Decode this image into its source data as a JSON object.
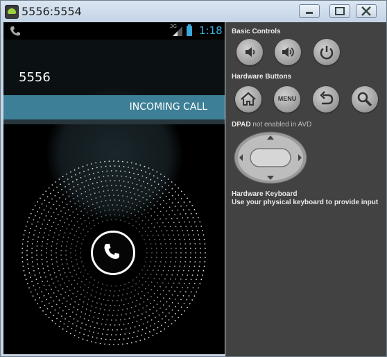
{
  "window": {
    "title": "5556:5554"
  },
  "phone": {
    "status_time": "1:18",
    "network_label": "3G",
    "caller": "5556",
    "incoming_label": "INCOMING CALL"
  },
  "controls": {
    "basic_controls_title": "Basic Controls",
    "hardware_buttons_title": "Hardware Buttons",
    "menu_label": "MENU",
    "dpad_title": "DPAD",
    "dpad_note": "not enabled in AVD",
    "keyboard_title": "Hardware Keyboard",
    "keyboard_desc": "Use your physical keyboard to provide input"
  },
  "colors": {
    "accent": "#33b5e5",
    "incoming_bar": "#3d7f96",
    "panel": "#424242"
  }
}
